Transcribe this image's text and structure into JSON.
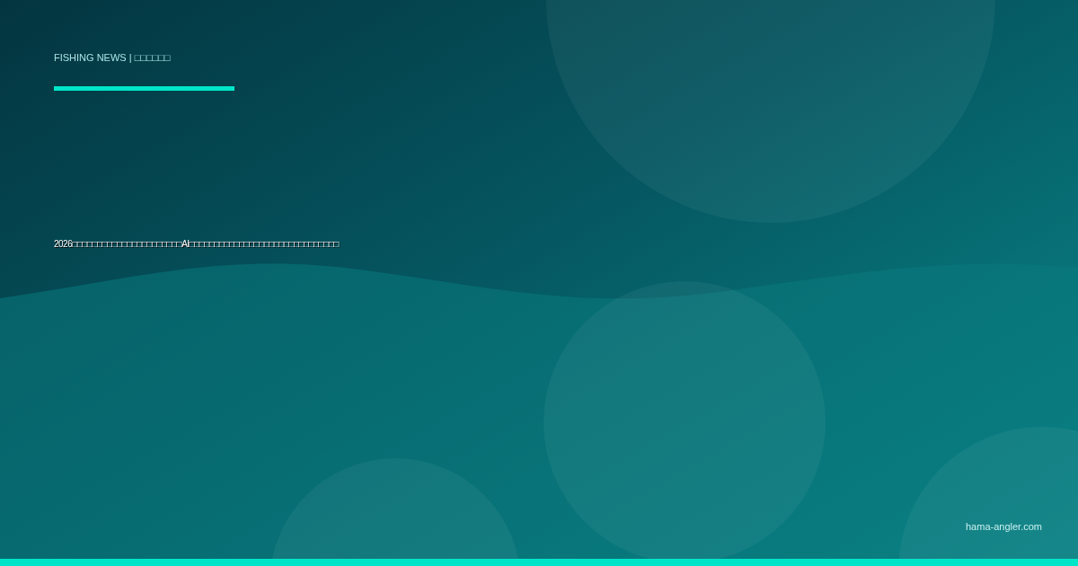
{
  "header": {
    "label": "FISHING NEWS | □□□□□□"
  },
  "headline": "2026□□□□□□□□□□□□□□□□□□□□□□AI□□□□□□□□□□□□□□□□□□□□□□□□□□□□□□",
  "footer": {
    "domain": "hama-angler.com"
  }
}
